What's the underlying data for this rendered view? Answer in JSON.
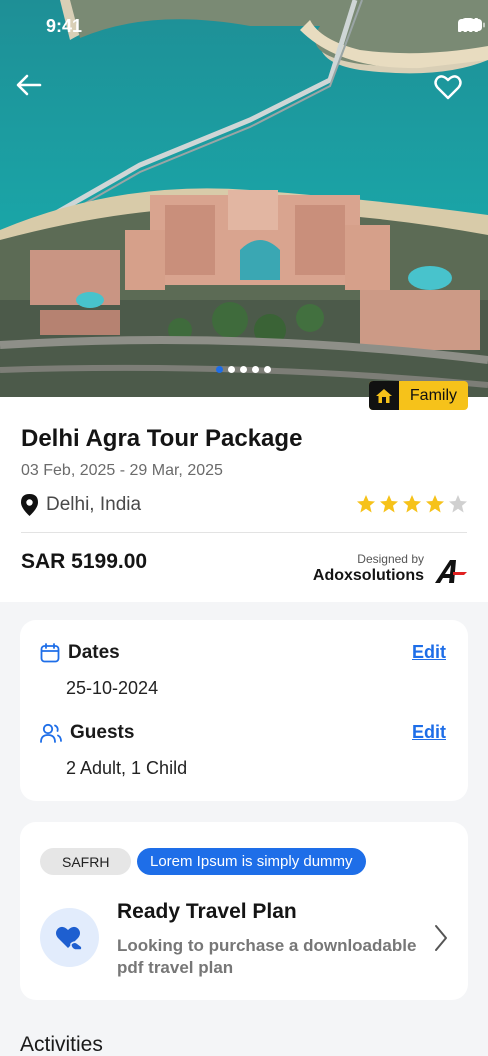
{
  "status_bar": {
    "time": "9:41"
  },
  "hero": {
    "badge_label": "Family",
    "slides": 5,
    "active_slide": 1
  },
  "package": {
    "title": "Delhi Agra Tour Package",
    "date_range": "03 Feb, 2025 - 29 Mar, 2025",
    "location": "Delhi, India",
    "rating": 4,
    "rating_max": 5,
    "price": "SAR 5199.00",
    "designed_by_label": "Designed by",
    "designer": "Adoxsolutions"
  },
  "booking": {
    "dates_label": "Dates",
    "dates_value": "25-10-2024",
    "guests_label": "Guests",
    "guests_value": "2 Adult, 1 Child",
    "edit_label": "Edit"
  },
  "plan": {
    "tag_gray": "SAFRH",
    "tag_blue": "Lorem Ipsum is simply dummy",
    "title": "Ready Travel Plan",
    "description": "Looking to purchase a downloadable pdf travel plan"
  },
  "section": {
    "activities_title": "Activities"
  },
  "colors": {
    "accent": "#1e6ee8",
    "badge": "#f6c21a",
    "star": "#f6c21a",
    "star_empty": "#d0d0d0"
  }
}
